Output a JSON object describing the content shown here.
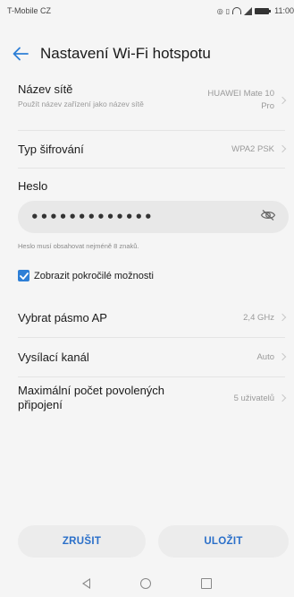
{
  "status_bar": {
    "carrier": "T-Mobile CZ",
    "time": "11:00"
  },
  "header": {
    "title": "Nastavení Wi-Fi hotspotu",
    "back_icon": "arrow-left-icon"
  },
  "settings": {
    "network_name": {
      "title": "Název sítě",
      "subtitle": "Použít název zařízení jako název sítě",
      "value_line1": "HUAWEI Mate 10",
      "value_line2": "Pro"
    },
    "encryption": {
      "title": "Typ šifrování",
      "value": "WPA2 PSK"
    },
    "password": {
      "title": "Heslo",
      "value": "•••••••••••••",
      "visibility_icon": "eye-off-icon",
      "hint": "Heslo musí obsahovat nejméně 8 znaků."
    },
    "advanced": {
      "label": "Zobrazit pokročilé možnosti",
      "checked": true
    },
    "ap_band": {
      "title": "Vybrat pásmo AP",
      "value": "2,4 GHz"
    },
    "channel": {
      "title": "Vysílací kanál",
      "value": "Auto"
    },
    "max_connections": {
      "title_line1": "Maximální počet povolených",
      "title_line2": "připojení",
      "value": "5 uživatelů"
    }
  },
  "actions": {
    "cancel": "ZRUŠIT",
    "save": "ULOŽIT"
  },
  "colors": {
    "accent": "#2e7fd6",
    "button_text": "#2a6fc9",
    "background": "#f5f5f5"
  }
}
